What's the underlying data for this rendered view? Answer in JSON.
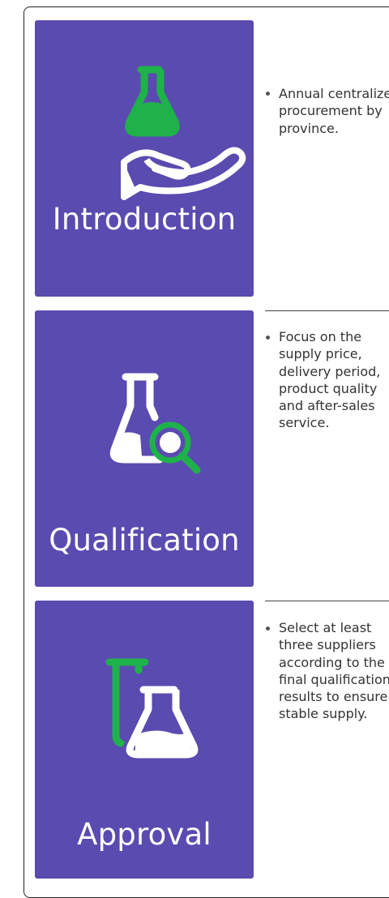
{
  "steps": [
    {
      "title": "Introduction",
      "icon": "flask-in-hand-icon",
      "bullet": "Annual centralized procurement by province."
    },
    {
      "title": "Qualification",
      "icon": "flask-magnifier-icon",
      "bullet": "Focus on the supply price, delivery period, product quality and after-sales service."
    },
    {
      "title": "Approval",
      "icon": "test-tube-and-flask-icon",
      "bullet": "Select at least three suppliers according to the final qualification results to ensure stable supply."
    }
  ],
  "colors": {
    "card": "#5a4bb0",
    "accent_green": "#1fb24a",
    "icon_white": "#ffffff",
    "text": "#333333",
    "frame": "#222222"
  }
}
